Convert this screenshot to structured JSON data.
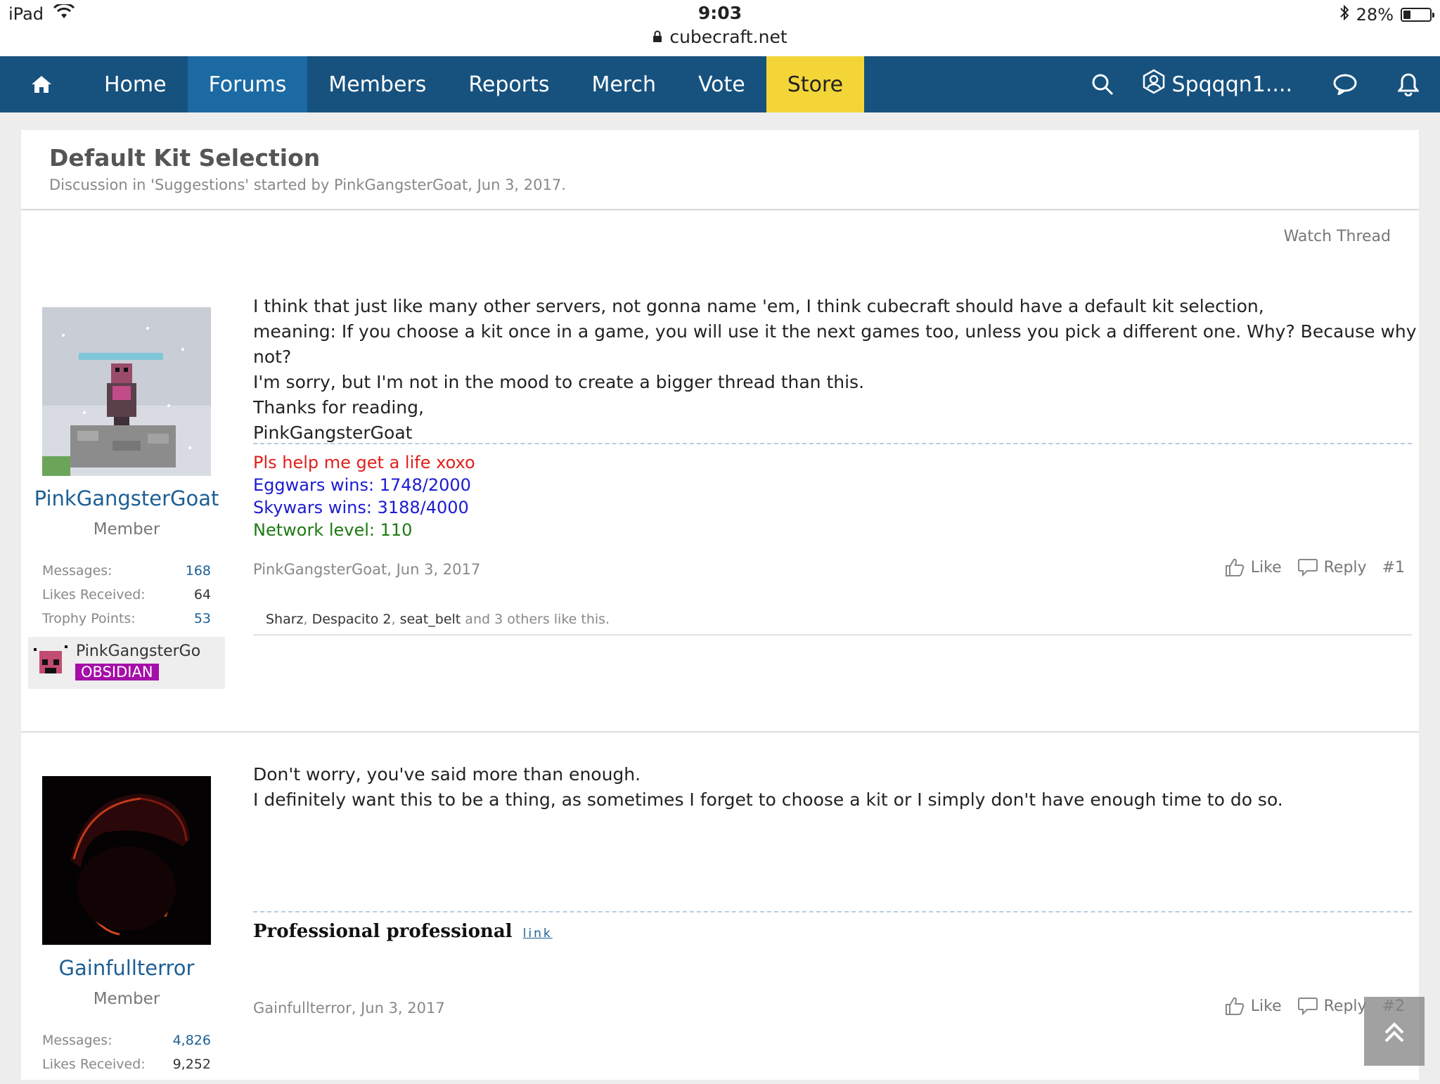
{
  "status_bar": {
    "device": "iPad",
    "time": "9:03",
    "url": "cubecraft.net",
    "battery": "28%"
  },
  "nav": {
    "items": [
      {
        "label": "Home"
      },
      {
        "label": "Forums"
      },
      {
        "label": "Members"
      },
      {
        "label": "Reports"
      },
      {
        "label": "Merch"
      },
      {
        "label": "Vote"
      },
      {
        "label": "Store"
      }
    ],
    "username": "Spqqqn1...."
  },
  "thread": {
    "title": "Default Kit Selection",
    "subtitle": "Discussion in 'Suggestions' started by PinkGangsterGoat, Jun 3, 2017.",
    "watch_label": "Watch Thread"
  },
  "posts": [
    {
      "username": "PinkGangsterGoat",
      "user_title": "Member",
      "stats": [
        {
          "label": "Messages:",
          "value": "168"
        },
        {
          "label": "Likes Received:",
          "value": "64"
        },
        {
          "label": "Trophy Points:",
          "value": "53"
        }
      ],
      "badge_name": "PinkGangsterGo",
      "badge_rank": "OBSIDIAN",
      "body": [
        "I think that just like many other servers, not gonna name 'em, I think cubecraft should have a default kit selection,",
        "meaning: If you choose a kit once in a game, you will use it the next games too, unless you pick a different one. Why? Because why not?",
        "I'm sorry, but I'm not in the mood to create a bigger thread than this.",
        "Thanks for reading,",
        "PinkGangsterGoat"
      ],
      "signature": [
        "Pls help me get a life xoxo",
        "Eggwars wins: 1748/2000",
        "Skywars wins: 3188/4000",
        "Network level: 110"
      ],
      "meta": "PinkGangsterGoat, Jun 3, 2017",
      "like_label": "Like",
      "reply_label": "Reply",
      "post_number": "#1",
      "likers": [
        "Sharz",
        "Despacito 2",
        "seat_belt"
      ],
      "likes_suffix": "and 3 others like this."
    },
    {
      "username": "Gainfullterror",
      "user_title": "Member",
      "stats": [
        {
          "label": "Messages:",
          "value": "4,826"
        },
        {
          "label": "Likes Received:",
          "value": "9,252"
        }
      ],
      "body": [
        "Don't worry, you've said more than enough.",
        "I definitely want this to be a thing, as sometimes I forget to choose a kit or I simply don't have enough time to do so."
      ],
      "signature_text": "Professional professional",
      "signature_link": "link",
      "meta": "Gainfullterror, Jun 3, 2017",
      "like_label": "Like",
      "reply_label": "Reply",
      "post_number": "#2"
    }
  ],
  "colors": {
    "nav_bg": "#17527f",
    "nav_active": "#1c6aa3",
    "store_bg": "#f3d538",
    "username": "#1c5f95",
    "rank_badge": "#a50ea8"
  }
}
